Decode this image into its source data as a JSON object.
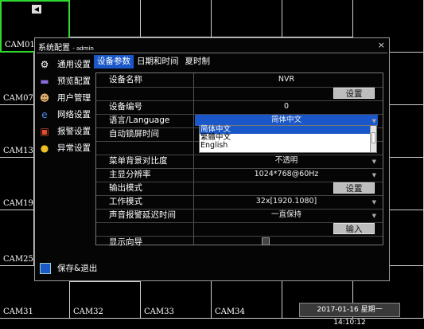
{
  "cameras": {
    "grid_labels": [
      "CAM01",
      "CAM07",
      "CAM13",
      "CAM19",
      "CAM25",
      "CAM31",
      "CAM32",
      "CAM33",
      "CAM34"
    ]
  },
  "timestamp": "2017-01-16 星期一 14:10:12",
  "dialog": {
    "title": "系统配置",
    "user": "- admin",
    "menu": [
      {
        "label": "通用设置",
        "icon": "gear-icon"
      },
      {
        "label": "预览配置",
        "icon": "monitor-icon"
      },
      {
        "label": "用户管理",
        "icon": "user-icon"
      },
      {
        "label": "网络设置",
        "icon": "network-icon"
      },
      {
        "label": "报警设置",
        "icon": "alarm-icon"
      },
      {
        "label": "异常设置",
        "icon": "warning-icon"
      }
    ],
    "save_exit": "保存&退出",
    "tabs": [
      "设备参数",
      "日期和时间",
      "夏时制"
    ],
    "rows": {
      "device_name": {
        "label": "设备名称",
        "value": "NVR"
      },
      "set_btn1": "设置",
      "device_id": {
        "label": "设备编号",
        "value": "0"
      },
      "language": {
        "label": "语言/Language",
        "value": "简体中文"
      },
      "auto_lock": {
        "label": "自动锁屏时间"
      },
      "menu_contrast": {
        "label": "菜单背景对比度",
        "value": "不透明"
      },
      "main_resolution": {
        "label": "主显分辨率",
        "value": "1024*768@60Hz"
      },
      "output_mode": {
        "label": "输出模式",
        "button": "设置"
      },
      "work_mode": {
        "label": "工作模式",
        "value": "32x[1920.1080]"
      },
      "alarm_delay": {
        "label": "声音报警延迟时间",
        "value": "一直保持"
      },
      "input_btn": "输入",
      "show_wizard": {
        "label": "显示向导"
      }
    },
    "language_options": [
      "简体中文",
      "繁體中文",
      "English"
    ]
  }
}
